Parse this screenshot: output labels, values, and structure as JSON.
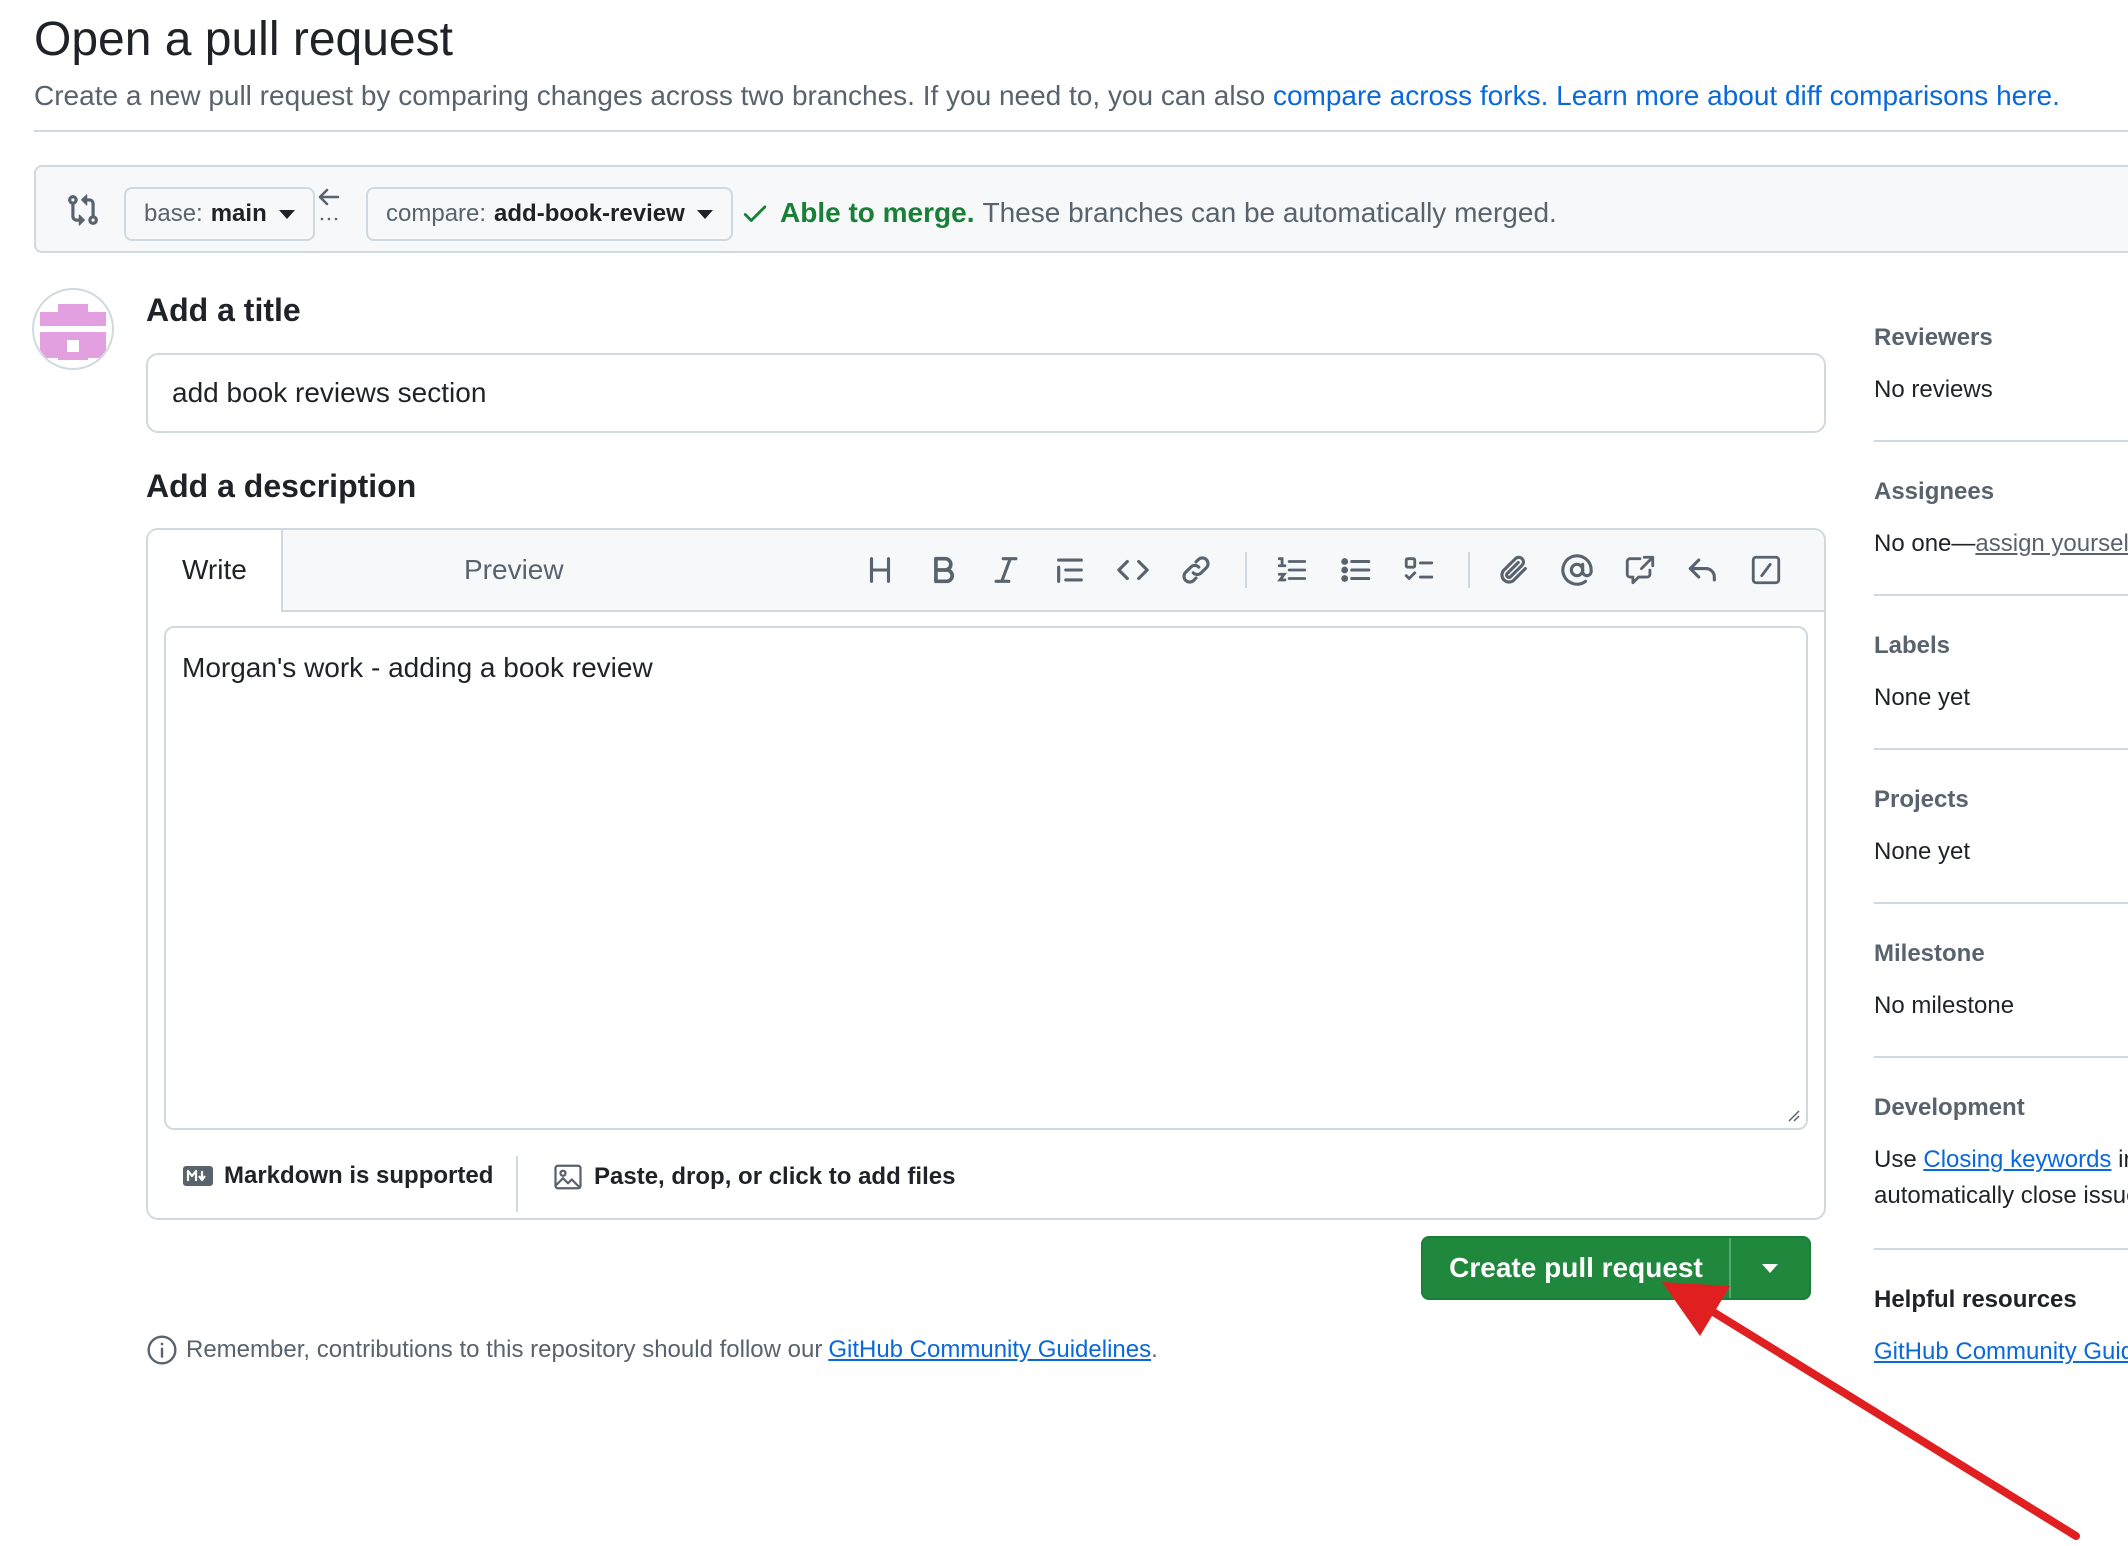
{
  "header": {
    "title": "Open a pull request",
    "subtitle_text": "Create a new pull request by comparing changes across two branches. If you need to, you can also ",
    "compare_forks_link": "compare across forks.",
    "learn_more_link": "Learn more about diff comparisons here."
  },
  "compare_bar": {
    "base_prefix": "base:",
    "base_branch": "main",
    "compare_prefix": "compare:",
    "compare_branch": "add-book-review",
    "merge_ok": "Able to merge.",
    "merge_text": "These branches can be automatically merged."
  },
  "form": {
    "title_label": "Add a title",
    "title_value": "add book reviews section",
    "description_label": "Add a description",
    "tabs": [
      "Write",
      "Preview"
    ],
    "description_value": "Morgan's work - adding a book review",
    "markdown_note": "Markdown is supported",
    "attach_note": "Paste, drop, or click to add files",
    "create_button": "Create pull request",
    "guidelines_prefix": "Remember, contributions to this repository should follow our",
    "guidelines_link": "GitHub Community Guidelines",
    "guidelines_suffix": "."
  },
  "sidebar": {
    "reviewers_label": "Reviewers",
    "reviewers_value": "No reviews",
    "assignees_label": "Assignees",
    "assignees_prefix": "No one—",
    "assignees_link": "assign yourself",
    "labels_label": "Labels",
    "labels_value": "None yet",
    "projects_label": "Projects",
    "projects_value": "None yet",
    "milestone_label": "Milestone",
    "milestone_value": "No milestone",
    "development_label": "Development",
    "development_prefix": "Use ",
    "development_link": "Closing keywords",
    "development_suffix": " in",
    "development_line2": "automatically close issues",
    "helpful_label": "Helpful resources",
    "helpful_link": "GitHub Community Guidelines"
  },
  "colors": {
    "accent": "#0969da",
    "success": "#1f883d",
    "annotation_arrow": "#e02020",
    "avatar": "#e3a0e0"
  },
  "icons": [
    "compare-icon",
    "arrow-left-icon",
    "check-icon",
    "heading-icon",
    "bold-icon",
    "italic-icon",
    "quote-icon",
    "code-icon",
    "link-icon",
    "ordered-list-icon",
    "unordered-list-icon",
    "task-list-icon",
    "paperclip-icon",
    "mention-icon",
    "cross-reference-icon",
    "reply-icon",
    "slash-command-icon",
    "markdown-icon",
    "image-icon",
    "info-icon"
  ]
}
